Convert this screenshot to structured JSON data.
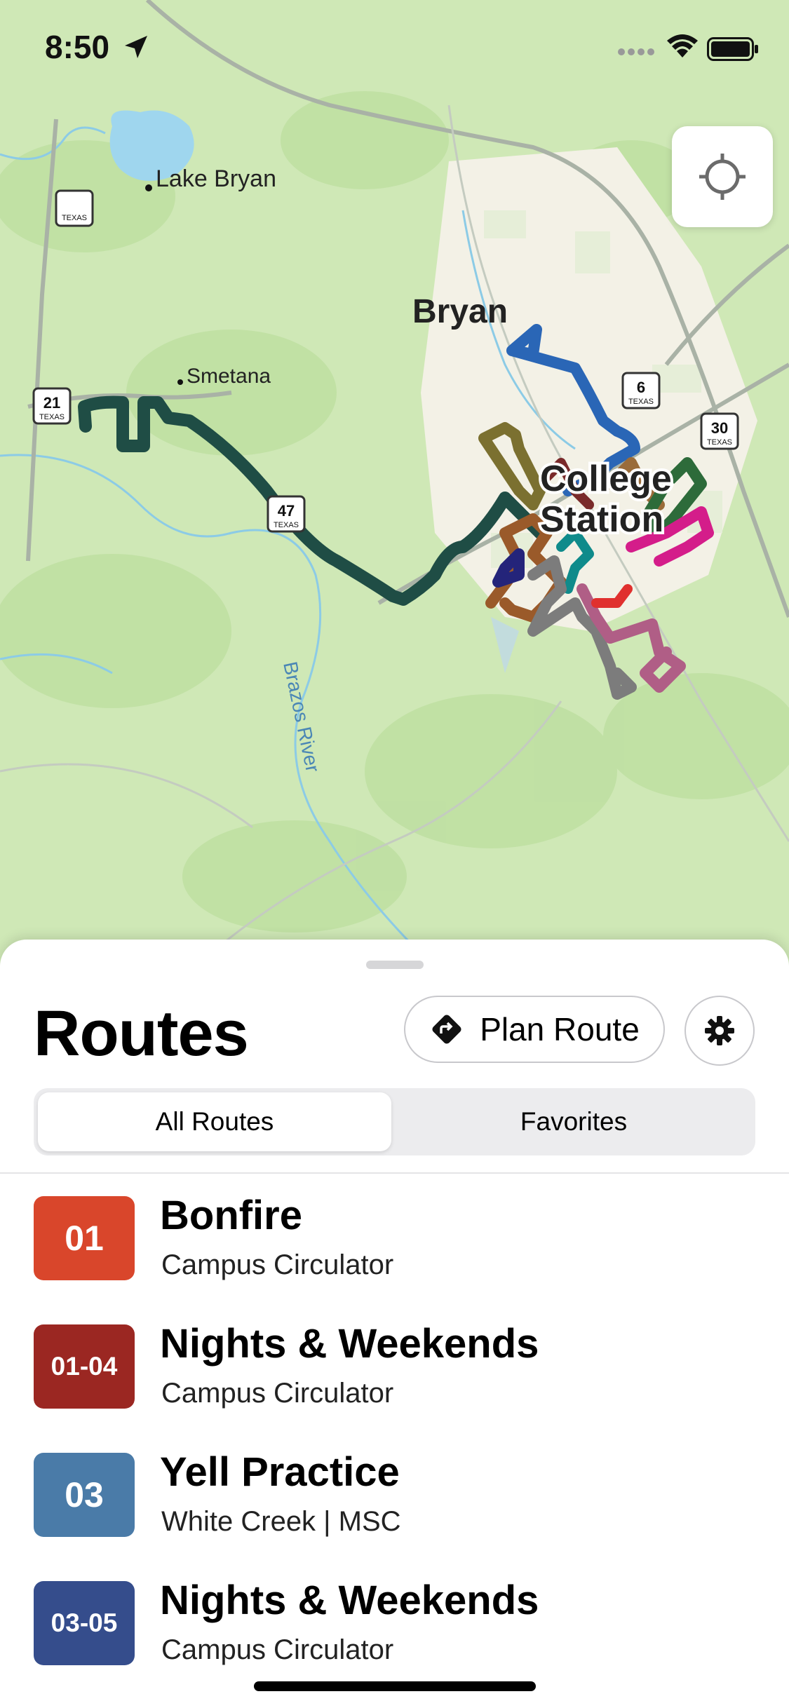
{
  "status_bar": {
    "time": "8:50"
  },
  "map": {
    "place_labels": {
      "lake_bryan": "Lake Bryan",
      "bryan": "Bryan",
      "smetana": "Smetana",
      "college_station_1": "College",
      "college_station_2": "Station",
      "brazos_river": "Brazos River"
    },
    "highway_shields": {
      "tx_unlabeled": "",
      "tx21": "21",
      "tx47": "47",
      "tx6": "6",
      "tx30": "30",
      "state": "TEXAS"
    }
  },
  "sheet": {
    "title": "Routes",
    "plan_route_label": "Plan Route",
    "tabs": [
      {
        "label": "All Routes",
        "selected": true
      },
      {
        "label": "Favorites",
        "selected": false
      }
    ]
  },
  "routes": [
    {
      "number": "01",
      "name": "Bonfire",
      "subtitle": "Campus Circulator",
      "color": "#d9462b"
    },
    {
      "number": "01-04",
      "name": "Nights & Weekends",
      "subtitle": "Campus Circulator",
      "color": "#9b2722"
    },
    {
      "number": "03",
      "name": "Yell Practice",
      "subtitle": "White Creek | MSC",
      "color": "#4a7ba8"
    },
    {
      "number": "03-05",
      "name": "Nights & Weekends",
      "subtitle": "Campus Circulator",
      "color": "#354d8c"
    }
  ]
}
